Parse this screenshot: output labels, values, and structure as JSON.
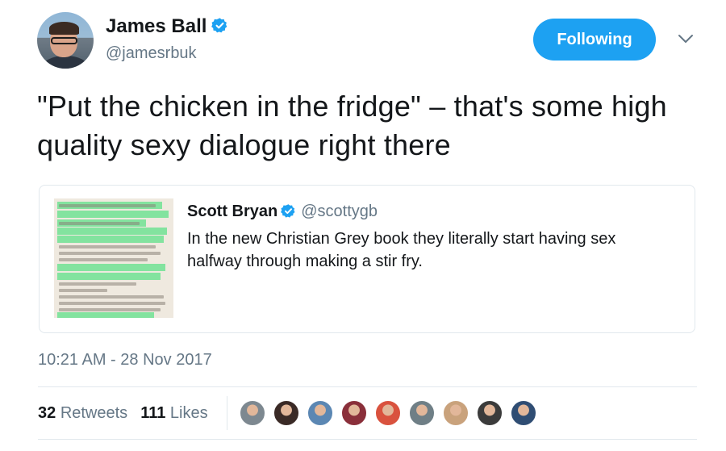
{
  "author": {
    "name": "James Ball",
    "handle": "@jamesrbuk",
    "verified_color": "#1da1f2",
    "avatar_icon": "profile-photo"
  },
  "follow_button": {
    "label": "Following",
    "color": "#1da1f2"
  },
  "menu_icon": "chevron-down-icon",
  "tweet": {
    "text": "\"Put the chicken in the fridge\" – that's some high quality sexy dialogue right there"
  },
  "quoted_tweet": {
    "name": "Scott Bryan",
    "handle": "@scottygb",
    "text": "In the new Christian Grey book they literally start having sex halfway through making a stir fry.",
    "image_icon": "book-page-photo"
  },
  "timestamp": "10:21 AM - 28 Nov 2017",
  "stats": {
    "retweets_count": "32",
    "retweets_label": "Retweets",
    "likes_count": "111",
    "likes_label": "Likes"
  },
  "likers": [
    {
      "icon": "avatar",
      "color": "#7d8890"
    },
    {
      "icon": "avatar",
      "color": "#3a2a26"
    },
    {
      "icon": "avatar",
      "color": "#5b87b3"
    },
    {
      "icon": "avatar",
      "color": "#8a2f3a"
    },
    {
      "icon": "avatar",
      "color": "#d9523e"
    },
    {
      "icon": "avatar",
      "color": "#6f7f86"
    },
    {
      "icon": "avatar",
      "color": "#c9a27c"
    },
    {
      "icon": "avatar",
      "color": "#3b3b3b"
    },
    {
      "icon": "avatar",
      "color": "#2f4d73"
    }
  ]
}
